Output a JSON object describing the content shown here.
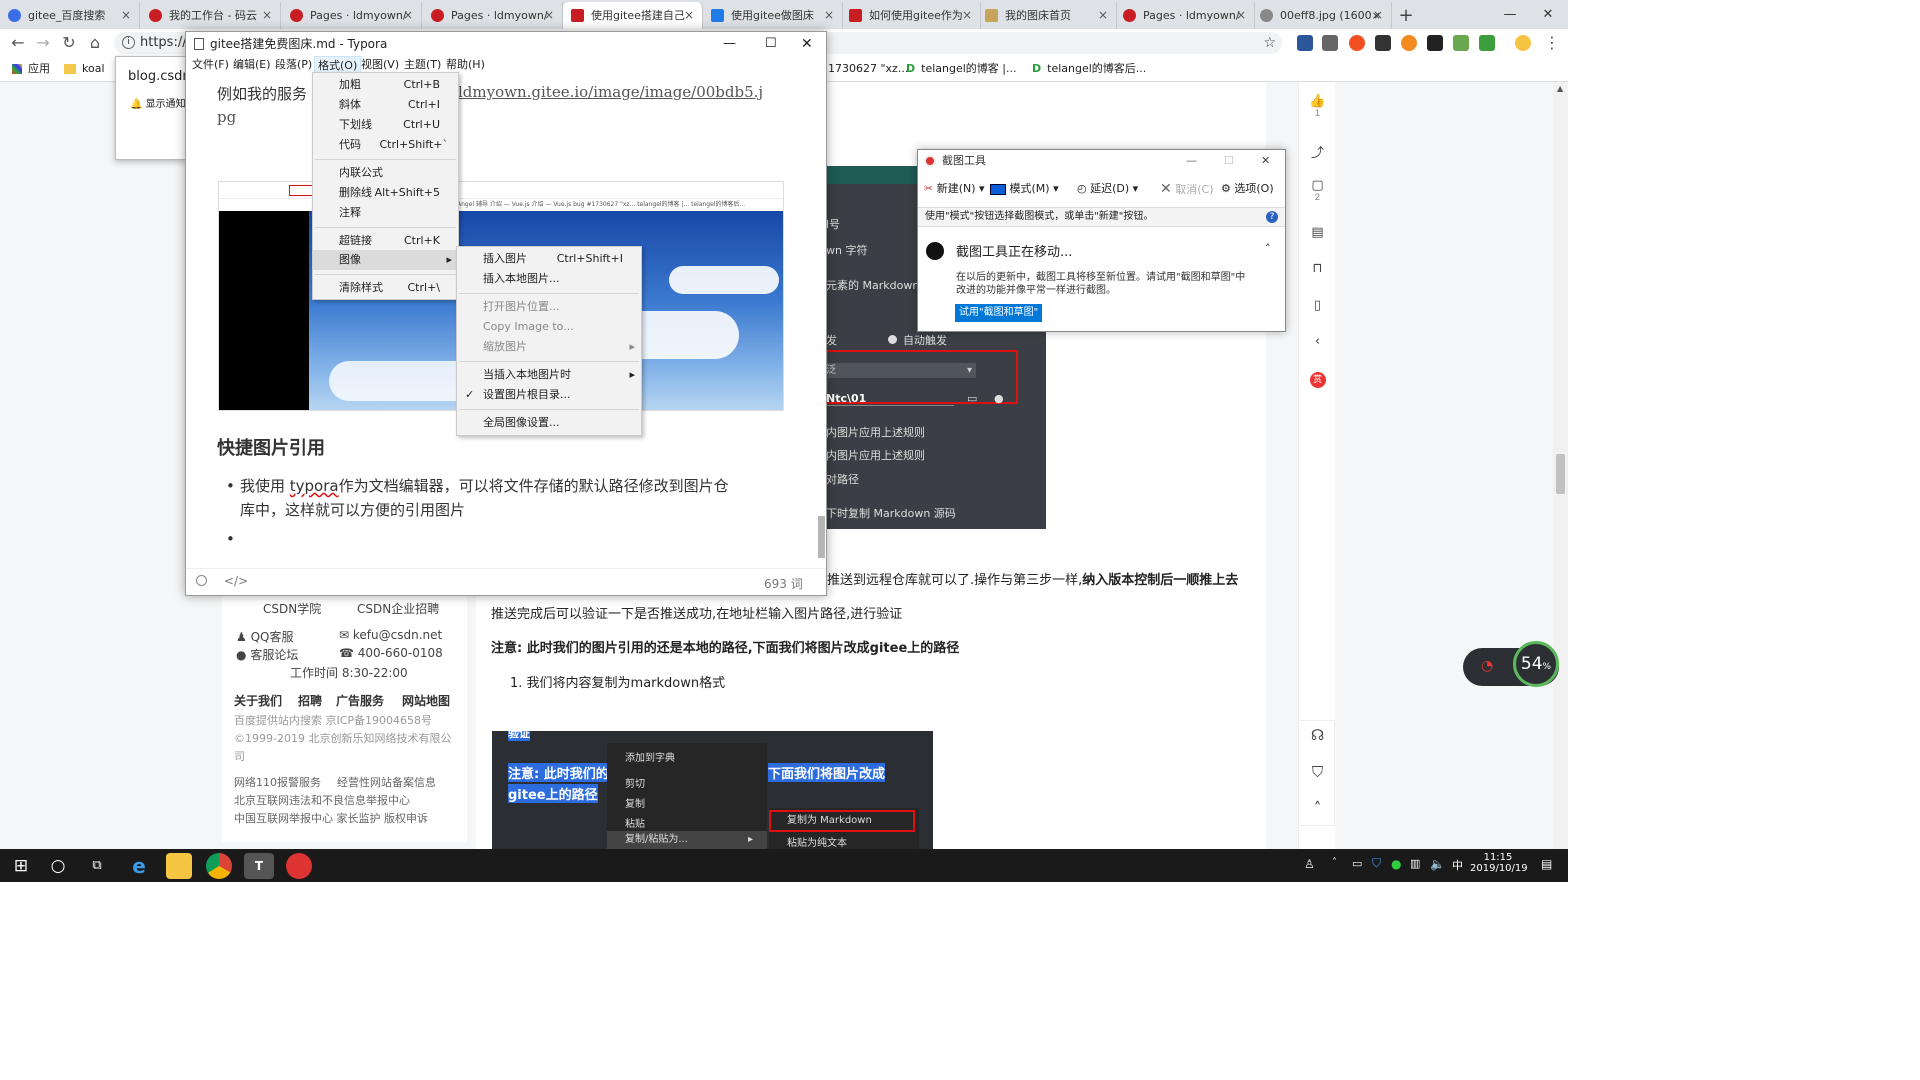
{
  "browser": {
    "tabs": [
      {
        "label": "gitee_百度搜索"
      },
      {
        "label": "我的工作台 - 码云"
      },
      {
        "label": "Pages · ldmyown/"
      },
      {
        "label": "Pages · ldmyown/"
      },
      {
        "label": "使用gitee搭建自己"
      },
      {
        "label": "使用gitee做图床"
      },
      {
        "label": "如何使用gitee作为"
      },
      {
        "label": "我的图床首页"
      },
      {
        "label": "Pages · ldmyown/"
      },
      {
        "label": "00eff8.jpg (1600×"
      }
    ],
    "new_tab": "+",
    "close_glyph": "×",
    "win_min": "—",
    "win_max": "❐",
    "win_close": "✕",
    "url": "https://",
    "bookmarks": [
      {
        "label": "应用"
      },
      {
        "label": "koal"
      },
      {
        "label": "1730627 \"xz..."
      },
      {
        "label": "telangel的博客 |..."
      },
      {
        "label": "telangel的博客后..."
      }
    ],
    "notification": {
      "title": "blog.csdn",
      "line": "显示通知"
    }
  },
  "typora": {
    "title": "gitee搭建免费图床.md - Typora",
    "menu": [
      "文件(F)",
      "编辑(E)",
      "段落(P)",
      "格式(O)",
      "视图(V)",
      "主题(T)",
      "帮助(H)"
    ],
    "line1": "例如我的服务",
    "link": "ldmyown.gitee.io/image/image/00bdb5.j",
    "link2": "pg",
    "heading": "快捷图片引用",
    "bullet1a": "我使用 ",
    "bullet1b": "typora",
    "bullet1c": "作为文档编辑器，可以将文件存储的默认路径修改到图片仓",
    "bullet1d": "库中，这样就可以方便的引用图片",
    "wordcount": "693 词",
    "mini_bookmarks": "TelAngel  辅导  介绍 — Vue.js  介绍 — Vue.js  bug #1730627 \"xz...  telangel的博客 |...  telangel的博客后..."
  },
  "format_menu": [
    {
      "label": "加粗",
      "shortcut": "Ctrl+B"
    },
    {
      "label": "斜体",
      "shortcut": "Ctrl+I"
    },
    {
      "label": "下划线",
      "shortcut": "Ctrl+U"
    },
    {
      "label": "代码",
      "shortcut": "Ctrl+Shift+`"
    },
    {
      "label": "内联公式",
      "shortcut": ""
    },
    {
      "label": "删除线",
      "shortcut": "Alt+Shift+5"
    },
    {
      "label": "注释",
      "shortcut": ""
    },
    {
      "label": "超链接",
      "shortcut": "Ctrl+K"
    },
    {
      "label": "图像",
      "shortcut": ""
    },
    {
      "label": "清除样式",
      "shortcut": "Ctrl+\\"
    }
  ],
  "image_menu": [
    {
      "label": "插入图片",
      "shortcut": "Ctrl+Shift+I"
    },
    {
      "label": "插入本地图片...",
      "shortcut": ""
    },
    {
      "label": "打开图片位置...",
      "shortcut": ""
    },
    {
      "label": "Copy Image to...",
      "shortcut": ""
    },
    {
      "label": "缩放图片",
      "shortcut": ""
    },
    {
      "label": "当插入本地图片时",
      "shortcut": ""
    },
    {
      "label": "设置图片根目录...",
      "shortcut": ""
    },
    {
      "label": "全局图像设置...",
      "shortcut": ""
    }
  ],
  "snip": {
    "title": "截图工具",
    "new": "新建(N)",
    "mode": "模式(M)",
    "delay": "延迟(D)",
    "cancel": "取消(C)",
    "options": "选项(O)",
    "hint": "使用\"模式\"按钮选择截图模式，或单击\"新建\"按钮。",
    "heading": "截图工具正在移动...",
    "body1": "在以后的更新中，截图工具将移至新位置。请试用\"截图和草图\"中",
    "body2": "改进的功能并像平常一样进行截图。",
    "button": "试用\"截图和草图\""
  },
  "dark_panel": {
    "rows": [
      "l号",
      "wn 字符",
      "元素的 Markdown 源",
      "发",
      "自动触发",
      "泛",
      "Ntc\\01",
      "内图片应用上述规则",
      "内图片应用上述规则",
      "对路径",
      "下时复制 Markdown 源码"
    ]
  },
  "article": {
    "p1a": "推送到远程仓库就可以了.操作与第三步一样,",
    "p1b": "纳入版本控制后一顺推上去",
    "p2": "推送完成后可以验证一下是否推送成功,在地址栏输入图片路径,进行验证",
    "p3": "注意: 此时我们的图片引用的还是本地的路径,下面我们将图片改成gitee上的路径",
    "li1": "1. 我们将内容复制为markdown格式",
    "shot": {
      "caption1": "注意: 此时我们的",
      "caption1b": "下面我们将图片改成",
      "caption2": "gitee上的路径",
      "top_fragment": "验证",
      "menu": [
        "添加到字典",
        "剪切",
        "复制",
        "粘贴",
        "复制/粘贴为..."
      ],
      "submenu": [
        "复制为 Markdown",
        "粘贴为纯文本"
      ]
    }
  },
  "footer": {
    "links": [
      "CSDN学院",
      "CSDN企业招聘"
    ],
    "qq": "QQ客服",
    "email": "kefu@csdn.net",
    "forum": "客服论坛",
    "phone": "400-660-0108",
    "hours": "工作时间 8:30-22:00",
    "nav": [
      "关于我们",
      "招聘",
      "广告服务",
      "网站地图"
    ],
    "icp": "百度提供站内搜索 京ICP备19004658号",
    "copy": "©1999-2019 北京创新乐知网络技术有限公司",
    "r1a": "网络110报警服务",
    "r1b": "经营性网站备案信息",
    "r2": "北京互联网违法和不良信息举报中心",
    "r3": "中国互联网举报中心 家长监护 版权申诉"
  },
  "sidebar": {
    "like_count": "1",
    "comment_count": "2"
  },
  "widget": {
    "percent": "54",
    "unit": "%"
  },
  "taskbar": {
    "time": "11:15",
    "date": "2019/10/19",
    "ime": "中"
  }
}
